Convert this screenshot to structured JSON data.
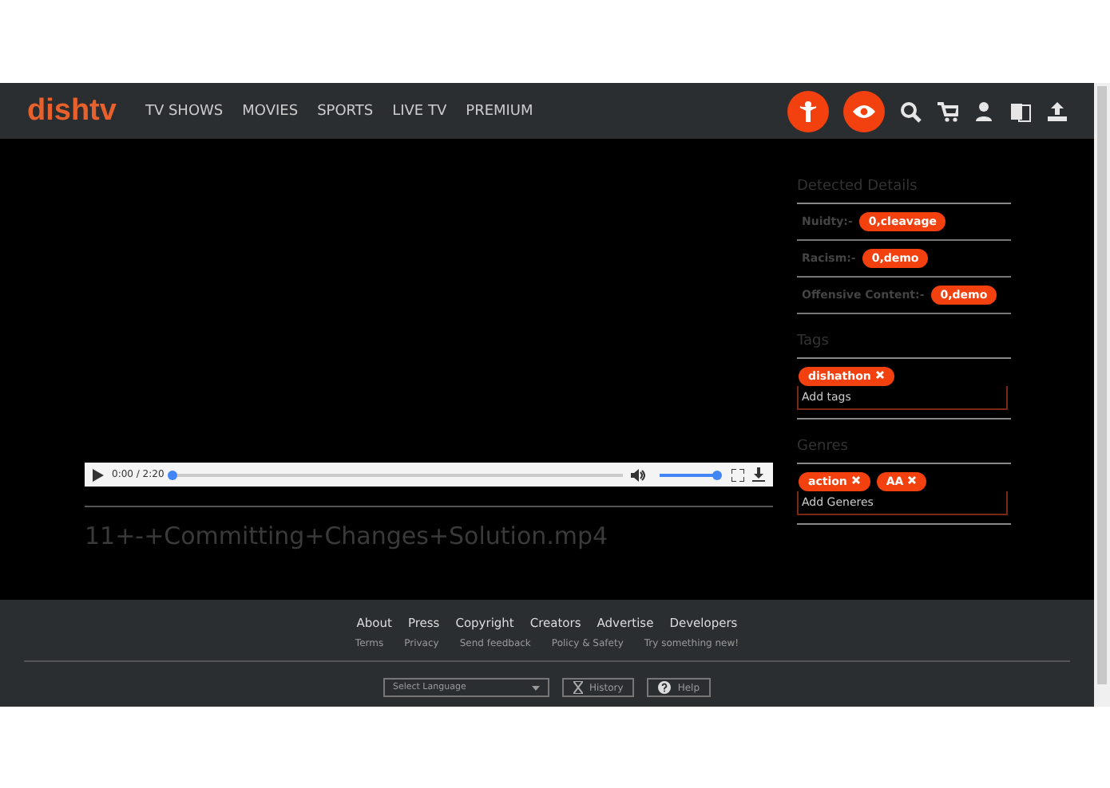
{
  "nav": {
    "logo": "dishtv",
    "items": [
      "TV SHOWS",
      "MOVIES",
      "SPORTS",
      "LIVE TV",
      "PREMIUM"
    ]
  },
  "player": {
    "time": "0:00 / 2:20",
    "progress": {
      "level": 0
    },
    "volume": {
      "level": 1
    },
    "title": "11+-+Committing+Changes+Solution.mp4"
  },
  "detected": {
    "heading": "Detected Details",
    "items": [
      {
        "label": "Nuidty:-",
        "value": "0,cleavage"
      },
      {
        "label": "Racism:-",
        "value": "0,demo"
      },
      {
        "label": "Offensive Content:-",
        "value": "0,demo"
      }
    ]
  },
  "tags": {
    "heading": "Tags",
    "chips": [
      "dishathon"
    ],
    "placeholder": "Add tags"
  },
  "genres": {
    "heading": "Genres",
    "chips": [
      "action",
      "AA"
    ],
    "placeholder": "Add Generes"
  },
  "footer": {
    "links": [
      "About",
      "Press",
      "Copyright",
      "Creators",
      "Advertise",
      "Developers"
    ],
    "sublinks": [
      "Terms",
      "Privacy",
      "Send feedback",
      "Policy & Safety",
      "Try something new!"
    ],
    "language": "Select Language",
    "buttons": [
      {
        "kind": "history",
        "label": "History"
      },
      {
        "kind": "help",
        "label": "Help"
      }
    ]
  }
}
